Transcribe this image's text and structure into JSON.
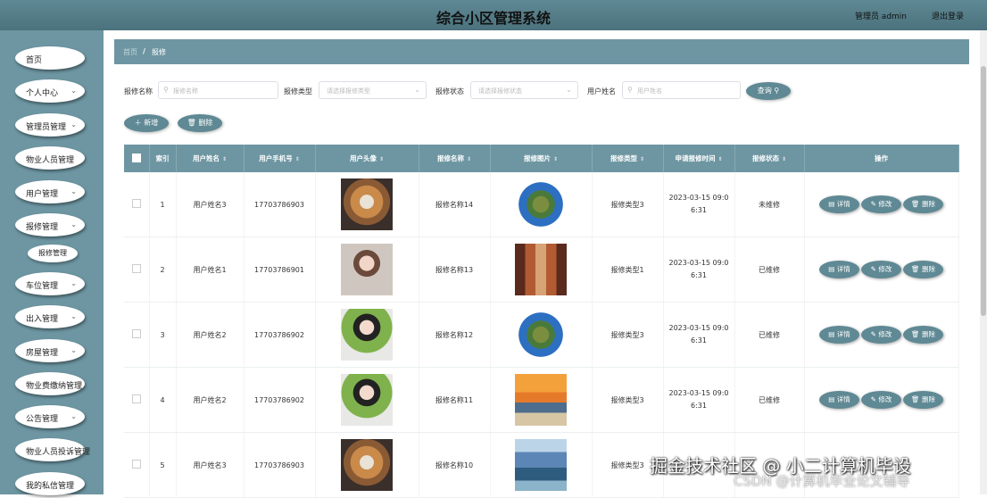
{
  "header": {
    "title": "综合小区管理系统",
    "admin_label": "管理员 admin",
    "logout_label": "退出登录"
  },
  "sidebar": {
    "items": [
      {
        "label": "首页",
        "chevron": false
      },
      {
        "label": "个人中心",
        "chevron": true
      },
      {
        "label": "管理员管理",
        "chevron": true
      },
      {
        "label": "物业人员管理",
        "chevron": false
      },
      {
        "label": "用户管理",
        "chevron": true
      },
      {
        "label": "报修管理",
        "chevron": true
      },
      {
        "label": "车位管理",
        "chevron": true
      },
      {
        "label": "出入管理",
        "chevron": true
      },
      {
        "label": "房屋管理",
        "chevron": true
      },
      {
        "label": "物业费缴纳管理",
        "chevron": false
      },
      {
        "label": "公告管理",
        "chevron": true
      },
      {
        "label": "物业人员投诉管理",
        "chevron": false
      },
      {
        "label": "我的私信管理",
        "chevron": false
      }
    ],
    "sub_item": "报修管理"
  },
  "breadcrumb": {
    "home": "首页",
    "separator": "/",
    "current": "报修"
  },
  "filters": {
    "name_label": "报修名称",
    "name_placeholder": "报修名称",
    "type_label": "报修类型",
    "type_placeholder": "请选择报修类型",
    "status_label": "报修状态",
    "status_placeholder": "请选择报修状态",
    "user_label": "用户姓名",
    "user_placeholder": "用户姓名",
    "search_button": "查询"
  },
  "actions": {
    "add": "新增",
    "delete": "删除"
  },
  "table": {
    "columns": [
      "索引",
      "用户姓名",
      "用户手机号",
      "用户头像",
      "报修名称",
      "报修图片",
      "报修类型",
      "申请报修时间",
      "报修状态",
      "操作"
    ],
    "row_actions": {
      "detail": "详情",
      "edit": "修改",
      "delete": "删除"
    },
    "rows": [
      {
        "index": "1",
        "user": "用户姓名3",
        "phone": "17703786903",
        "avatar": "dog",
        "name": "报修名称14",
        "photo": "planet",
        "type": "报修类型3",
        "time_1": "2023-03-15 09:0",
        "time_2": "6:31",
        "status": "未维修"
      },
      {
        "index": "2",
        "user": "用户姓名1",
        "phone": "17703786901",
        "avatar": "woman1",
        "name": "报修名称13",
        "photo": "corridor",
        "type": "报修类型1",
        "time_1": "2023-03-15 09:0",
        "time_2": "6:31",
        "status": "已维修"
      },
      {
        "index": "3",
        "user": "用户姓名2",
        "phone": "17703786902",
        "avatar": "woman2",
        "name": "报修名称12",
        "photo": "planet",
        "type": "报修类型3",
        "time_1": "2023-03-15 09:0",
        "time_2": "6:31",
        "status": "已维修"
      },
      {
        "index": "4",
        "user": "用户姓名2",
        "phone": "17703786902",
        "avatar": "woman2",
        "name": "报修名称11",
        "photo": "sunset",
        "type": "报修类型3",
        "time_1": "2023-03-15 09:0",
        "time_2": "6:31",
        "status": "已维修"
      },
      {
        "index": "5",
        "user": "用户姓名3",
        "phone": "17703786903",
        "avatar": "dog",
        "name": "报修名称10",
        "photo": "coast",
        "type": "报修类型3",
        "time_1": "",
        "time_2": "",
        "status": ""
      }
    ]
  },
  "watermark": {
    "line1": "掘金技术社区 @ 小二计算机毕设",
    "line2": "CSDN @计算机毕业论文辅导"
  },
  "colors": {
    "header_bg": "#5f8994",
    "sidebar_bg": "#6d96a2",
    "button_bg": "#5f8994"
  }
}
